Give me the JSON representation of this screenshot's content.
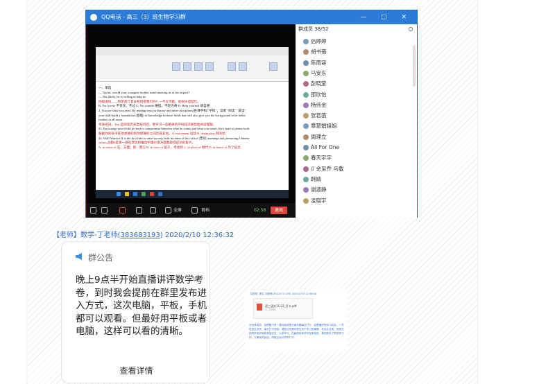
{
  "qq_window": {
    "title": "QQ电话 - 高三（3）班生物学习群",
    "controls": [
      "—",
      "□",
      "✕"
    ],
    "document_lines": [
      {
        "text": "一、单选",
        "red": false
      },
      {
        "text": "— Taylor, would your youngest brother mind meeting us at the airport?",
        "red": false
      },
      {
        "text": "— Not likely, he is willing to help us.",
        "red": false
      },
      {
        "text": "你知道吗——你弟弟介意去机场接我们吗？一不太可能，他很乐意帮忙。",
        "red": true
      },
      {
        "text": "B. For lovely  不仅仅，不过   C. No wonder  难怪，不足为奇  D. Help yourself  请自便",
        "red": false
      },
      {
        "text": "2. You are what you read. By reading texts in history and other disciplines(各课学科)\"学科\"；读者 \"阅读\" \"爱读\"",
        "red": false
      },
      {
        "text": "your skill build a foundation (基础) of knowledge in these fields that will also give you the background to be better",
        "red": false
      },
      {
        "text": "readers in all areas.",
        "red": false
      },
      {
        "text": "考查名词。You 是阅读历史类知识的，要学习一些相关的学科知识来帮助阅读理解。",
        "red": true
      },
      {
        "text": "23. Encourage your child to reach a compromise between what he wants and what you want if he's hard to please both.",
        "red": false
      },
      {
        "text": "鼓励你的孩子在他想要的和你想要的之间达成妥协。A. movement 运动  B. destination 目的地",
        "red": true
      },
      {
        "text": "24. Wolf Warrior II is the first film to raise success both in terms of box office (票房) earnings and promoting Chinese",
        "red": false
      },
      {
        "text": "values.战狼2是第一部在票房和推动中国价值方面都取得成功的影片。",
        "red": true
      },
      {
        "text": "A. in terms of 在…方面；就…而言  B. in view of 鉴于，考虑到  C. in place of 替代  D. in honor of 为了纪念",
        "red": true
      }
    ],
    "video_controls": {
      "screen_share": "全屏",
      "desktop": "首档",
      "duration": "02:58",
      "exit": "退出"
    },
    "members": {
      "header": "群成员 38/52",
      "list": [
        "后婷婷",
        "胡书蓓",
        "陈雨容",
        "马安东",
        "彭晓莹",
        "邵欣怡",
        "杨伟金",
        "张若菡",
        "章慧娟姐姐",
        "周理立",
        "All For One",
        "春天宇宇",
        "// 余至乔  马载",
        "韩婧",
        "谢淑静",
        "凌晓宇"
      ]
    }
  },
  "message": {
    "sender_prefix": "【老师】数学-丁老师(",
    "sender_qq": "383683193",
    "sender_suffix": ") 2020/2/10 12:36:32"
  },
  "announcement": {
    "heading": "群公告",
    "body": "晚上9点半开始直播讲评数学考卷，到时我会提前在群里发布进入方式，这次电脑，平板，手机都可以观看。但最好用平板或者电脑，这样可以看的清晰。",
    "more": "查看详情"
  },
  "thumbnail": {
    "sender_line": "【老师】语文-刘老师(3312073 103) 2020/2/10 12:58:44",
    "file_name": "语三语文11-22_打卡.pdf",
    "file_size": "(2.35MB)",
    "text": "@全体成员，这是晚下来一课对阅读语文每天跟每日打卡，这是最好的学习机会，一次性发过去完，每天打卡完成。请各位在群内提交关于学习的事情，写点名分类，但提交的同学也好和老师加好友，为多学习，在面前有序好写在家检查，是在那外了同学学习的，方便安同步加，同家互动与同学打卡。"
  }
}
